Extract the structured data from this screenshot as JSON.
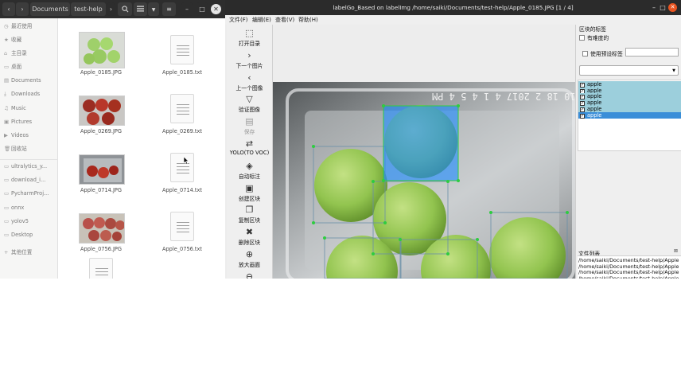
{
  "file_manager": {
    "header": {
      "back_icon": "chevron-left-icon",
      "forward_icon": "chevron-right-icon",
      "path_segments": [
        "Documents",
        "test-help"
      ],
      "search_icon": "search-icon",
      "view_icon": "list-view-icon",
      "sort_icon": "chevron-down-icon",
      "menu_icon": "hamburger-menu-icon",
      "minimize": "–",
      "maximize": "□",
      "close": "✕"
    },
    "sidebar": [
      {
        "icon": "clock-icon",
        "glyph": "◷",
        "label": "最近使用"
      },
      {
        "icon": "star-icon",
        "glyph": "★",
        "label": "收藏"
      },
      {
        "icon": "home-icon",
        "glyph": "⌂",
        "label": "主目录"
      },
      {
        "icon": "desktop-icon",
        "glyph": "▭",
        "label": "桌面"
      },
      {
        "icon": "document-icon",
        "glyph": "▤",
        "label": "Documents"
      },
      {
        "icon": "download-icon",
        "glyph": "⤓",
        "label": "Downloads"
      },
      {
        "icon": "music-icon",
        "glyph": "♫",
        "label": "Music"
      },
      {
        "icon": "pictures-icon",
        "glyph": "▣",
        "label": "Pictures"
      },
      {
        "icon": "video-icon",
        "glyph": "▶",
        "label": "Videos"
      },
      {
        "icon": "trash-icon",
        "glyph": "🗑",
        "label": "回收站"
      },
      {
        "icon": "folder-icon",
        "glyph": "▭",
        "label": "ultralytics_y..."
      },
      {
        "icon": "folder-icon",
        "glyph": "▭",
        "label": "download_i..."
      },
      {
        "icon": "folder-icon",
        "glyph": "▭",
        "label": "PycharmProj..."
      },
      {
        "icon": "folder-icon",
        "glyph": "▭",
        "label": "onnx"
      },
      {
        "icon": "folder-icon",
        "glyph": "▭",
        "label": "yolov5"
      },
      {
        "icon": "folder-icon",
        "glyph": "▭",
        "label": "Desktop"
      },
      {
        "icon": "plus-icon",
        "glyph": "+",
        "label": "其他位置"
      }
    ],
    "files": [
      {
        "name": "Apple_0185.JPG",
        "kind": "image"
      },
      {
        "name": "Apple_0185.txt",
        "kind": "text"
      },
      {
        "name": "Apple_0269.JPG",
        "kind": "image"
      },
      {
        "name": "Apple_0269.txt",
        "kind": "text"
      },
      {
        "name": "Apple_0714.JPG",
        "kind": "image"
      },
      {
        "name": "Apple_0714.txt",
        "kind": "text"
      },
      {
        "name": "Apple_0756.JPG",
        "kind": "image"
      },
      {
        "name": "Apple_0756.txt",
        "kind": "text"
      }
    ]
  },
  "labelimg": {
    "title": "labelGo_Based on labelImg /home/saiki/Documents/test-help/Apple_0185.JPG [1 / 4]",
    "window_controls": {
      "minimize": "–",
      "maximize": "□",
      "close": "✕"
    },
    "menu": [
      "文件(F)",
      "编辑(E)",
      "查看(V)",
      "帮助(H)"
    ],
    "tools": [
      {
        "label": "打开目录",
        "icon": "folder-open-icon",
        "glyph": "⬚",
        "enabled": true
      },
      {
        "label": "下一个图片",
        "icon": "next-icon",
        "glyph": "›",
        "enabled": true
      },
      {
        "label": "上一个图像",
        "icon": "previous-icon",
        "glyph": "‹",
        "enabled": true
      },
      {
        "label": "验证图像",
        "icon": "verify-icon",
        "glyph": "▽",
        "enabled": true
      },
      {
        "label": "保存",
        "icon": "save-icon",
        "glyph": "▤",
        "enabled": false
      },
      {
        "label": "YOLO(TO VOC)",
        "icon": "format-icon",
        "glyph": "⇄",
        "enabled": true
      },
      {
        "label": "自动标注",
        "icon": "auto-label-icon",
        "glyph": "◈",
        "enabled": true
      },
      {
        "label": "创建区块",
        "icon": "create-box-icon",
        "glyph": "▣",
        "enabled": true
      },
      {
        "label": "复制区块",
        "icon": "copy-box-icon",
        "glyph": "❐",
        "enabled": true
      },
      {
        "label": "删除区块",
        "icon": "delete-icon",
        "glyph": "✖",
        "enabled": true
      },
      {
        "label": "放大画面",
        "icon": "zoom-in-icon",
        "glyph": "⊕",
        "enabled": true
      },
      {
        "label": "",
        "icon": "zoom-out-icon",
        "glyph": "⊖",
        "enabled": true
      }
    ],
    "canvas": {
      "timestamp_text": "5 10 18 2 2017 4 1 4 5 4 PM"
    },
    "dock": {
      "title": "区块的标签",
      "difficult_label": "有难度的",
      "use_default_label": "使用预设标签",
      "default_label_value": "",
      "combo_value": "",
      "labels": [
        {
          "name": "apple",
          "checked": true,
          "selected": false
        },
        {
          "name": "apple",
          "checked": true,
          "selected": false
        },
        {
          "name": "apple",
          "checked": true,
          "selected": false
        },
        {
          "name": "apple",
          "checked": true,
          "selected": false
        },
        {
          "name": "apple",
          "checked": true,
          "selected": false
        },
        {
          "name": "apple",
          "checked": true,
          "selected": true
        }
      ],
      "file_list_title": "文件列表",
      "files": [
        "/home/saiki/Documents/test-help/Apple",
        "/home/saiki/Documents/test-help/Apple",
        "/home/saiki/Documents/test-help/Apple",
        "/home/saiki/Documents/test-help/Apple"
      ]
    },
    "colors": {
      "box_stroke": "#2ecc40",
      "selected_fill": "#1e8cff",
      "label_row": "#9ccfdc",
      "label_selected": "#3a8ed8"
    }
  }
}
